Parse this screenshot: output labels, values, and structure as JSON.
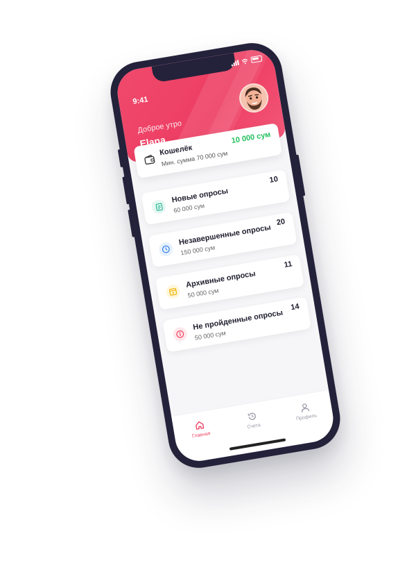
{
  "status": {
    "time": "9:41"
  },
  "header": {
    "greeting": "Доброе утро",
    "user_name": "Elana"
  },
  "wallet": {
    "title": "Кошелёк",
    "subtitle": "Мин. сумма 70 000 сум",
    "amount": "10 000 сум",
    "amount_color": "#22c15e",
    "icon": "wallet-icon"
  },
  "surveys": [
    {
      "title": "Новые опросы",
      "amount": "60 000 сум",
      "count": "10",
      "icon": "document-icon",
      "color": "#1fb58f",
      "bg": "#e6f7f2"
    },
    {
      "title": "Незавершенные опросы",
      "amount": "150 000 сум",
      "count": "20",
      "icon": "clock-icon",
      "color": "#2f7fe6",
      "bg": "#e8f1fd"
    },
    {
      "title": "Архивные опросы",
      "amount": "50 000 сум",
      "count": "11",
      "icon": "archive-icon",
      "color": "#f0b400",
      "bg": "#fff7dc"
    },
    {
      "title": "Не пройденные опросы",
      "amount": "50 000 сум",
      "count": "14",
      "icon": "alert-icon",
      "color": "#ef4460",
      "bg": "#fde8ec"
    }
  ],
  "tabs": [
    {
      "label": "Главная",
      "icon": "home-icon",
      "active": true
    },
    {
      "label": "Счета",
      "icon": "history-icon",
      "active": false
    },
    {
      "label": "Профиль",
      "icon": "user-icon",
      "active": false
    }
  ],
  "colors": {
    "brand": "#ee3d62",
    "frame": "#24213a"
  }
}
